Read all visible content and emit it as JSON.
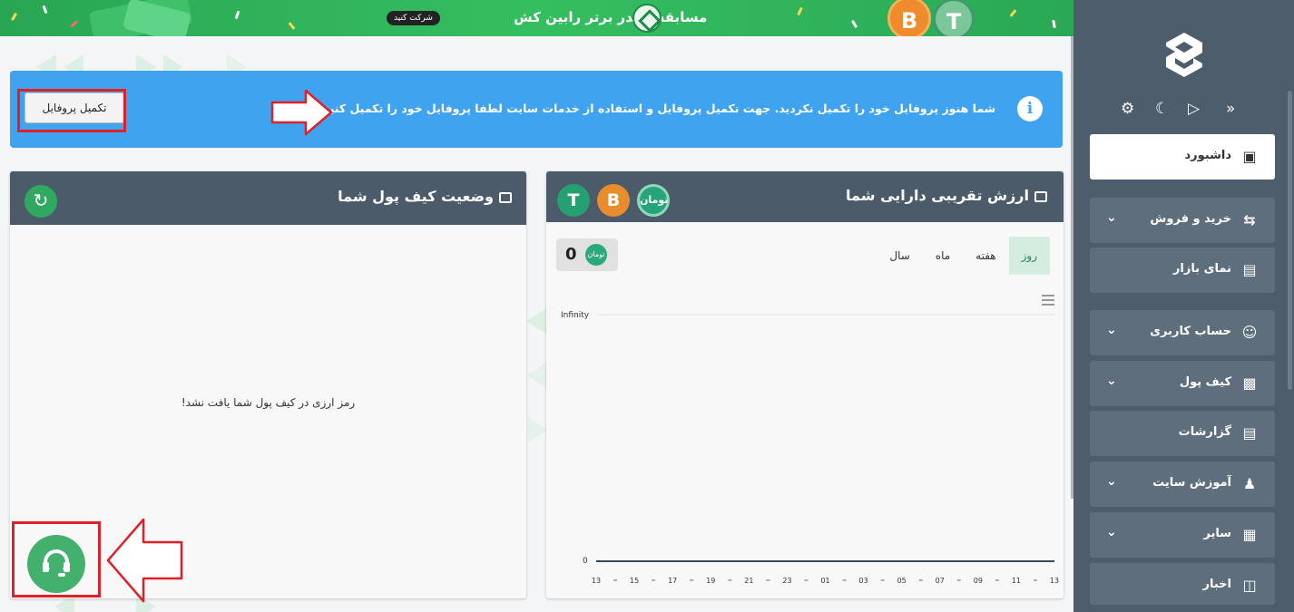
{
  "banner": {
    "title": "مسابقه تریدر برتر رابین کش",
    "button_label": "شرکت کنید"
  },
  "alert": {
    "icon": "info-icon",
    "message": "شما هنوز پروفایل خود را تکمیل نکردید. جهت تکمیل پروفایل و استفاده از خدمات سایت لطفا پروفایل خود را تکمیل کنید.",
    "button_label": "تکمیل پروفایل",
    "color": "#3fa3f0"
  },
  "wallet_card": {
    "title": "وضعیت کیف پول شما",
    "empty_message": "رمز ارزی در کیف پول شما یافت نشد!"
  },
  "value_card": {
    "title": "ارزش تقریبی دارایی شما",
    "tabs": [
      "روز",
      "هفته",
      "ماه",
      "سال"
    ],
    "active_tab": "روز",
    "balance": "0"
  },
  "chart_data": {
    "type": "line",
    "x": [
      "13",
      "15",
      "17",
      "19",
      "21",
      "23",
      "01",
      "03",
      "05",
      "07",
      "09",
      "11",
      "13"
    ],
    "series": [
      {
        "values": [
          0,
          0,
          0,
          0,
          0,
          0,
          0,
          0,
          0,
          0,
          0,
          0,
          0
        ]
      }
    ],
    "y_tick_labels": [
      "Infinity",
      "0"
    ],
    "grid": true
  },
  "sidebar": {
    "items": [
      {
        "label": "داشبورد",
        "icon": "monitor-icon",
        "active": true
      },
      {
        "label": "خرید و فروش",
        "icon": "swap-arrows-icon",
        "expandable": true
      },
      {
        "label": "نمای بازار",
        "icon": "market-chart-icon"
      },
      {
        "label": "حساب کاربری",
        "icon": "user-circle-icon",
        "expandable": true
      },
      {
        "label": "کیف پول",
        "icon": "wallet-icon",
        "expandable": true
      },
      {
        "label": "گزارشات",
        "icon": "report-icon"
      },
      {
        "label": "آموزش سایت",
        "icon": "help-user-icon",
        "expandable": true
      },
      {
        "label": "سایر",
        "icon": "grid-icon",
        "expandable": true
      },
      {
        "label": "اخبار",
        "icon": "news-icon"
      }
    ]
  },
  "colors": {
    "brand_green": "#2fa862",
    "sidebar_bg": "#4d5d6c",
    "card_header": "#4b5b6a",
    "highlight_red": "#e11f26"
  }
}
